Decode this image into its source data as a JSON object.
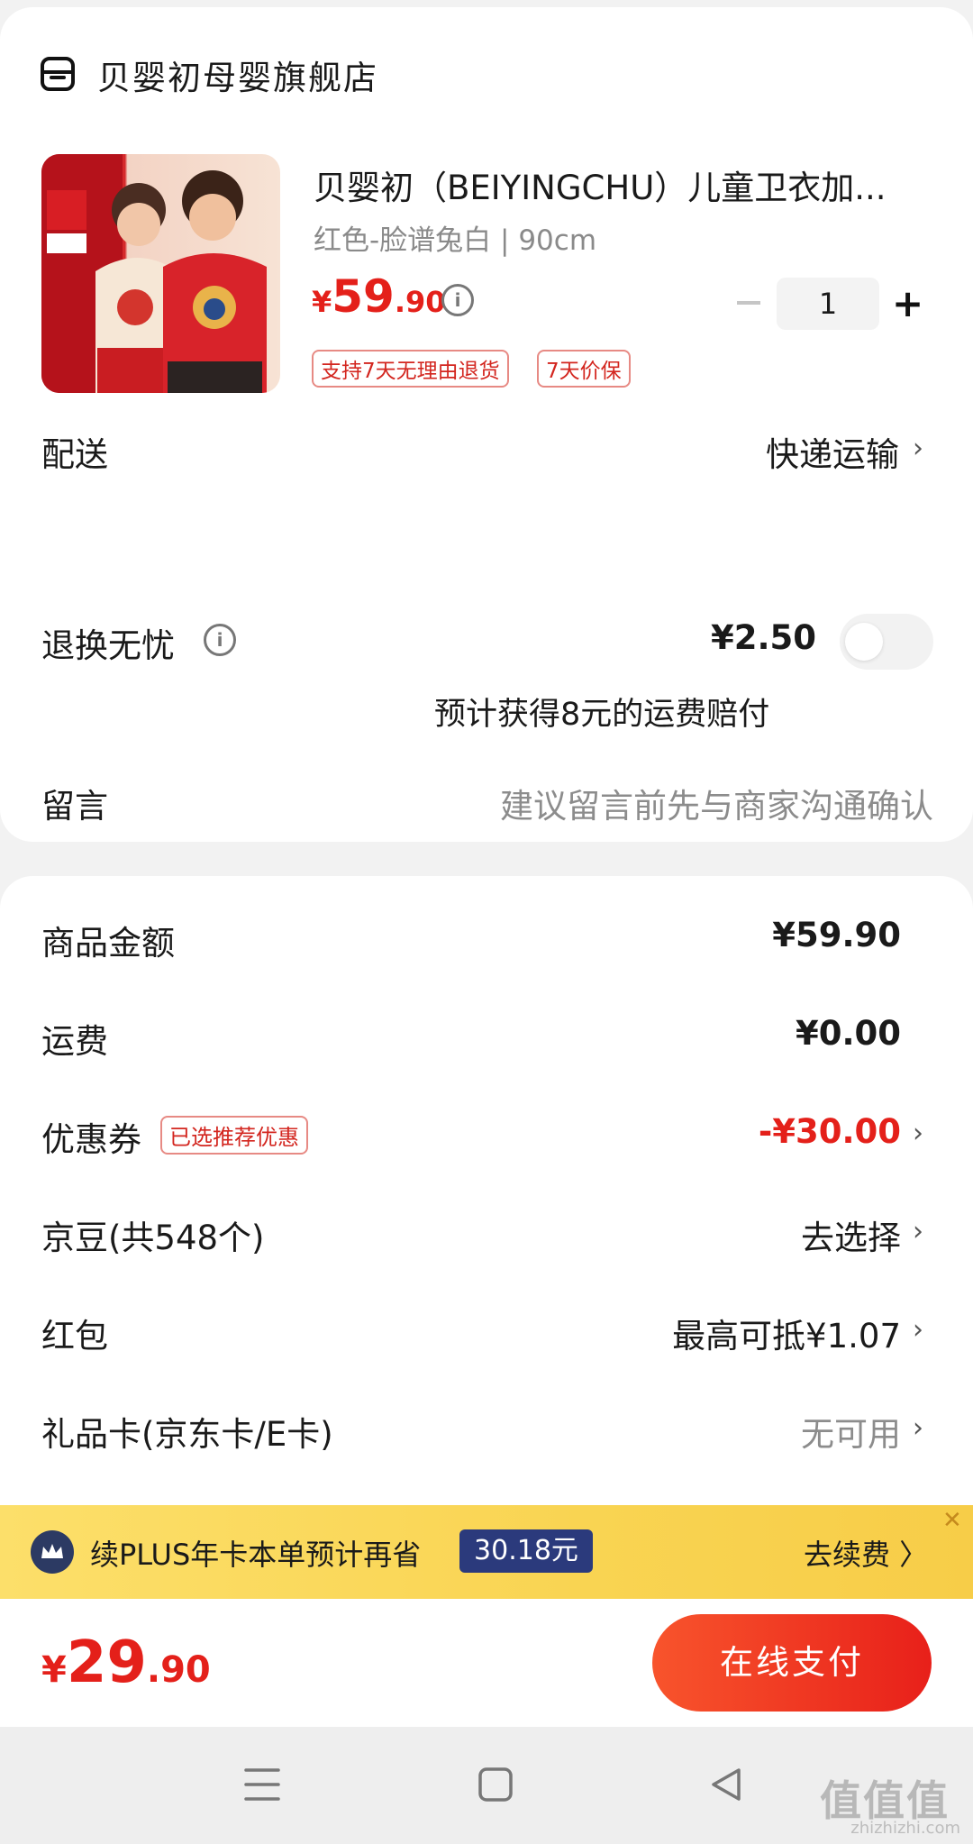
{
  "store": {
    "name": "贝婴初母婴旗舰店",
    "icon": "store-icon"
  },
  "product": {
    "title": "贝婴初（BEIYINGCHU）儿童卫衣加...",
    "spec": "红色-脸谱兔白 | 90cm",
    "price_symbol": "¥",
    "price_int": "59",
    "price_dec": ".90",
    "quantity": "1",
    "minus_label": "－",
    "plus_label": "+",
    "tags": [
      "支持7天无理由退货",
      "7天价保"
    ]
  },
  "shipping": {
    "label": "配送",
    "value": "快递运输"
  },
  "return_insurance": {
    "label": "退换无忧",
    "price": "¥2.50",
    "note": "预计获得8元的运费赔付",
    "enabled": false
  },
  "message": {
    "label": "留言",
    "placeholder": "建议留言前先与商家沟通确认"
  },
  "summary": {
    "goods": {
      "label": "商品金额",
      "value": "¥59.90"
    },
    "freight": {
      "label": "运费",
      "value": "¥0.00"
    },
    "coupon": {
      "label": "优惠券",
      "tag": "已选推荐优惠",
      "value": "-¥30.00"
    },
    "jingdou": {
      "label": "京豆(共548个)",
      "value": "去选择"
    },
    "redpacket": {
      "label": "红包",
      "value": "最高可抵¥1.07"
    },
    "giftcard": {
      "label": "礼品卡(京东卡/E卡)",
      "value": "无可用"
    }
  },
  "plus_banner": {
    "text": "续PLUS年卡本单预计再省",
    "amount": "30.18元",
    "action": "去续费 〉",
    "close": "✕"
  },
  "checkout": {
    "symbol": "¥",
    "total_int": "29",
    "total_dec": ".90",
    "pay_label": "在线支付"
  },
  "nav": {
    "menu": "menu-icon",
    "home": "home-square-icon",
    "back": "back-triangle-icon"
  },
  "watermark": {
    "text": "值值值",
    "url": "zhizhizhi.com"
  },
  "colors": {
    "accent_red": "#e4201a",
    "plus_yellow": "#f9d452",
    "plus_navy": "#2b3a7c"
  }
}
